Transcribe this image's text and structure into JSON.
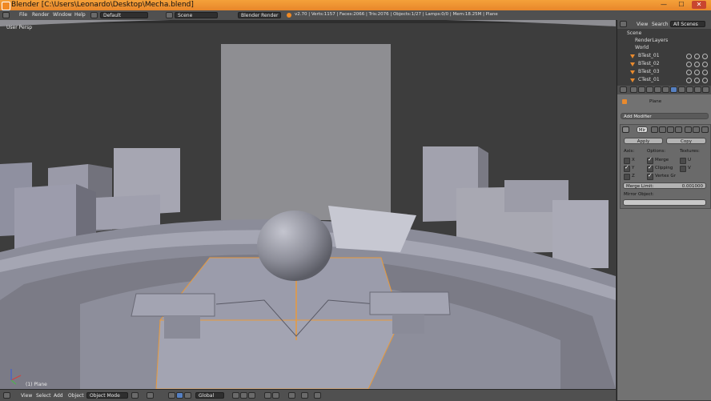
{
  "window": {
    "title": "Blender [C:\\Users\\Leonardo\\Desktop\\Mecha.blend]",
    "minimize": "—",
    "maximize": "☐",
    "close": "✕"
  },
  "info_header": {
    "menus": [
      "File",
      "Render",
      "Window",
      "Help"
    ],
    "layout_value": "Default",
    "scene_value": "Scene",
    "engine_value": "Blender Render",
    "stats": "v2.70 | Verts:1157 | Faces:2066 | Tris:2076 | Objects:1/27 | Lamps:0/0 | Mem:18.25M | Plane"
  },
  "viewport": {
    "view_label": "User Persp",
    "object_label": "(1) Plane"
  },
  "view_header": {
    "menus": [
      "View",
      "Select",
      "Add",
      "Object"
    ],
    "mode_value": "Object Mode",
    "pivot_value": "Global"
  },
  "outliner": {
    "tabs": [
      "View",
      "Search",
      "All Scenes"
    ],
    "items": [
      {
        "name": "Scene"
      },
      {
        "name": "RenderLayers"
      },
      {
        "name": "World"
      },
      {
        "name": "BTest_01"
      },
      {
        "name": "BTest_02"
      },
      {
        "name": "BTest_03"
      },
      {
        "name": "CTest_01"
      }
    ]
  },
  "properties": {
    "breadcrumb_object": "Plane",
    "add_modifier": "Add Modifier",
    "modifier_name": "Mir",
    "apply_label": "Apply",
    "copy_label": "Copy",
    "axis_heading": "Axis:",
    "options_heading": "Options:",
    "textures_heading": "Textures:",
    "axis_x": "X",
    "axis_y": "Y",
    "axis_z": "Z",
    "opt_merge": "Merge",
    "opt_clipping": "Clipping",
    "opt_vertex": "Vertex Gr",
    "tex_u": "U",
    "tex_v": "V",
    "merge_limit_label": "Merge Limit:",
    "merge_limit_value": "0.001000",
    "mirror_object_label": "Mirror Object:"
  },
  "colors": {
    "title_bar": "#f0952f",
    "header": "#505050",
    "viewport_bg": "#3d3d3d",
    "selection_outline": "#e89a3c",
    "properties_bg": "#727272"
  }
}
